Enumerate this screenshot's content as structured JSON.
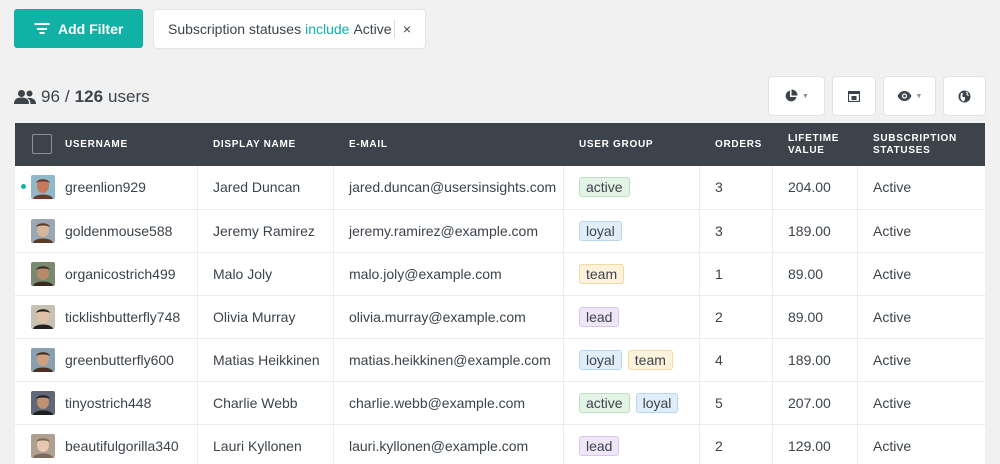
{
  "toolbar": {
    "add_filter_label": "Add Filter",
    "filter": {
      "field": "Subscription statuses",
      "operator": "include",
      "value": "Active",
      "close": "×"
    }
  },
  "summary": {
    "shown": "96",
    "separator": "/",
    "total": "126",
    "unit": "users"
  },
  "view_buttons": [
    {
      "icon": "pie-chart-icon",
      "has_dropdown": true
    },
    {
      "icon": "columns-icon",
      "has_dropdown": false
    },
    {
      "icon": "eye-icon",
      "has_dropdown": true
    },
    {
      "icon": "globe-icon",
      "has_dropdown": false
    }
  ],
  "table": {
    "columns": {
      "username": "USERNAME",
      "display_name": "DISPLAY NAME",
      "email": "E-MAIL",
      "user_group": "USER GROUP",
      "orders": "ORDERS",
      "lifetime_value_1": "LIFETIME",
      "lifetime_value_2": "VALUE",
      "subscription_1": "SUBSCRIPTION",
      "subscription_2": "STATUSES"
    },
    "rows": [
      {
        "username": "greenlion929",
        "display_name": "Jared Duncan",
        "email": "jared.duncan@usersinsights.com",
        "groups": [
          "active"
        ],
        "orders": "3",
        "lifetime_value": "204.00",
        "status": "Active",
        "online": true
      },
      {
        "username": "goldenmouse588",
        "display_name": "Jeremy Ramirez",
        "email": "jeremy.ramirez@example.com",
        "groups": [
          "loyal"
        ],
        "orders": "3",
        "lifetime_value": "189.00",
        "status": "Active",
        "online": false
      },
      {
        "username": "organicostrich499",
        "display_name": "Malo Joly",
        "email": "malo.joly@example.com",
        "groups": [
          "team"
        ],
        "orders": "1",
        "lifetime_value": "89.00",
        "status": "Active",
        "online": false
      },
      {
        "username": "ticklishbutterfly748",
        "display_name": "Olivia Murray",
        "email": "olivia.murray@example.com",
        "groups": [
          "lead"
        ],
        "orders": "2",
        "lifetime_value": "89.00",
        "status": "Active",
        "online": false
      },
      {
        "username": "greenbutterfly600",
        "display_name": "Matias Heikkinen",
        "email": "matias.heikkinen@example.com",
        "groups": [
          "loyal",
          "team"
        ],
        "orders": "4",
        "lifetime_value": "189.00",
        "status": "Active",
        "online": false
      },
      {
        "username": "tinyostrich448",
        "display_name": "Charlie Webb",
        "email": "charlie.webb@example.com",
        "groups": [
          "active",
          "loyal"
        ],
        "orders": "5",
        "lifetime_value": "207.00",
        "status": "Active",
        "online": false
      },
      {
        "username": "beautifulgorilla340",
        "display_name": "Lauri Kyllonen",
        "email": "lauri.kyllonen@example.com",
        "groups": [
          "lead"
        ],
        "orders": "2",
        "lifetime_value": "129.00",
        "status": "Active",
        "online": false
      }
    ]
  },
  "group_colors": {
    "active": {
      "bg": "#e3f3e6",
      "border": "#b9e0c1"
    },
    "loyal": {
      "bg": "#e0eefa",
      "border": "#b7d6f0"
    },
    "team": {
      "bg": "#fdf3dc",
      "border": "#f1dba3"
    },
    "lead": {
      "bg": "#efe6f8",
      "border": "#d8c6ee"
    }
  },
  "colors": {
    "accent": "#11b2a5",
    "header_bg": "#3c434a",
    "text": "#3c434a"
  }
}
